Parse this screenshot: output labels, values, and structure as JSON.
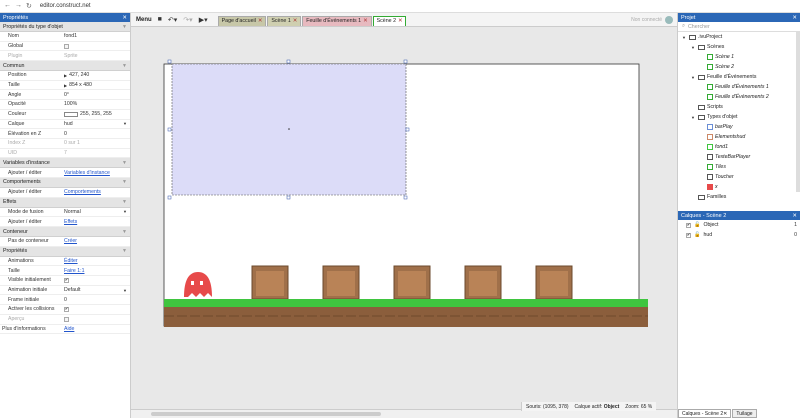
{
  "browser": {
    "url": "editor.construct.net"
  },
  "left_panel": {
    "title": "Propriétés",
    "sections": [
      {
        "label": "Propriétés du type d'objet",
        "rows": [
          {
            "key": "Nom",
            "value": "fond1",
            "kind": "text"
          },
          {
            "key": "Global",
            "value": "",
            "kind": "checkbox-off"
          },
          {
            "key": "Plugin",
            "value": "Sprite",
            "kind": "dim",
            "dimkey": true
          }
        ]
      },
      {
        "label": "Commun",
        "rows": [
          {
            "key": "Position",
            "value": "427, 240",
            "kind": "tri"
          },
          {
            "key": "Taille",
            "value": "854 x 480",
            "kind": "tri"
          },
          {
            "key": "Angle",
            "value": "0°",
            "kind": "text"
          },
          {
            "key": "Opacité",
            "value": "100%",
            "kind": "text"
          },
          {
            "key": "Couleur",
            "value": "255, 255, 255",
            "kind": "swatch"
          },
          {
            "key": "Calque",
            "value": "hud",
            "kind": "dropdown"
          },
          {
            "key": "Élévation en Z",
            "value": "0",
            "kind": "text"
          },
          {
            "key": "Index Z",
            "value": "0 sur 1",
            "kind": "dim",
            "dimkey": true
          },
          {
            "key": "UID",
            "value": "7",
            "kind": "dim",
            "dimkey": true
          }
        ]
      },
      {
        "label": "Variables d'instance",
        "rows": [
          {
            "key": "Ajouter / éditer",
            "value": "Variables d'instance",
            "kind": "link"
          }
        ]
      },
      {
        "label": "Comportements",
        "rows": [
          {
            "key": "Ajouter / éditer",
            "value": "Comportements",
            "kind": "link"
          }
        ]
      },
      {
        "label": "Effets",
        "rows": [
          {
            "key": "Mode de fusion",
            "value": "Normal",
            "kind": "dropdown"
          },
          {
            "key": "Ajouter / éditer",
            "value": "Effets",
            "kind": "link"
          }
        ]
      },
      {
        "label": "Conteneur",
        "rows": [
          {
            "key": "Pas de conteneur",
            "value": "Créer",
            "kind": "link"
          }
        ]
      },
      {
        "label": "Propriétés",
        "rows": [
          {
            "key": "Animations",
            "value": "Éditer",
            "kind": "link"
          },
          {
            "key": "Taille",
            "value": "Faire 1:1",
            "kind": "link"
          },
          {
            "key": "Visible initialement",
            "value": "✔",
            "kind": "checkbox-on"
          },
          {
            "key": "Animation initiale",
            "value": "Default",
            "kind": "dropdown"
          },
          {
            "key": "Frame initiale",
            "value": "0",
            "kind": "text"
          },
          {
            "key": "Activer les collisions",
            "value": "✔",
            "kind": "checkbox-on"
          },
          {
            "key": "Aperçu",
            "value": "",
            "kind": "checkbox-off",
            "dimkey": true
          }
        ]
      }
    ],
    "footer_key": "Plus d'informations",
    "footer_link": "Aide"
  },
  "toolbar": {
    "menu_label": "Menu",
    "tabs": [
      {
        "label": "Page d'accueil",
        "color": "#c7c7a8",
        "closable": true
      },
      {
        "label": "Scène 1",
        "color": "#cfcfb0",
        "closable": true
      },
      {
        "label": "Feuille d'Événements 1",
        "color": "#e7b9bf",
        "closable": true
      },
      {
        "label": "Scène 2",
        "color": "#ffffff",
        "closable": true,
        "active": true
      }
    ],
    "signin_label": "Non connecté"
  },
  "status": {
    "mouse": "Souris: (1095, 378)",
    "layer": "Calque actif:",
    "layer_name": "Object",
    "zoom": "Zoom: 65 %"
  },
  "right_panel": {
    "title": "Projet",
    "search_placeholder": "Chercher",
    "tree": [
      {
        "label": ".ivuProject",
        "depth": 0,
        "icon": "folder",
        "open": true
      },
      {
        "label": "Scènes",
        "depth": 1,
        "icon": "folder",
        "open": true
      },
      {
        "label": "Scène 1",
        "depth": 2,
        "icon": "scene",
        "italic": true
      },
      {
        "label": "Scène 2",
        "depth": 2,
        "icon": "scene",
        "italic": true
      },
      {
        "label": "Feuille d'Événements",
        "depth": 1,
        "icon": "folder",
        "open": true
      },
      {
        "label": "Feuille d'Événements 1",
        "depth": 2,
        "icon": "events",
        "italic": true
      },
      {
        "label": "Feuille d'Événements 2",
        "depth": 2,
        "icon": "events",
        "italic": true
      },
      {
        "label": "Scripts",
        "depth": 1,
        "icon": "folder"
      },
      {
        "label": "Types d'objet",
        "depth": 1,
        "icon": "folder",
        "open": true
      },
      {
        "label": "barPlay",
        "depth": 2,
        "icon": "bar",
        "italic": true
      },
      {
        "label": "Elementshud",
        "depth": 2,
        "icon": "img",
        "italic": true
      },
      {
        "label": "fond1",
        "depth": 2,
        "icon": "line",
        "italic": true
      },
      {
        "label": "TexteBarPlayer",
        "depth": 2,
        "icon": "text",
        "italic": true
      },
      {
        "label": "Tiles",
        "depth": 2,
        "icon": "tiles",
        "italic": true
      },
      {
        "label": "Toucher",
        "depth": 2,
        "icon": "touch",
        "italic": true
      },
      {
        "label": "x",
        "depth": 2,
        "icon": "red",
        "italic": true
      },
      {
        "label": "Familles",
        "depth": 1,
        "icon": "folder"
      }
    ],
    "layers_title": "Calques - Scène 2",
    "layers": [
      {
        "name": "Object",
        "num": "1"
      },
      {
        "name": "hud",
        "num": "0"
      }
    ],
    "bottom_tabs": [
      "Calques - Scène 2",
      "Tuilage"
    ]
  },
  "colors": {
    "accent": "#2b67b6",
    "selection": "#dcdcf8",
    "grass": "#3fc53f",
    "dirt": "#8b5e3c",
    "door": "#a0704a",
    "character": "#e74a4a"
  }
}
